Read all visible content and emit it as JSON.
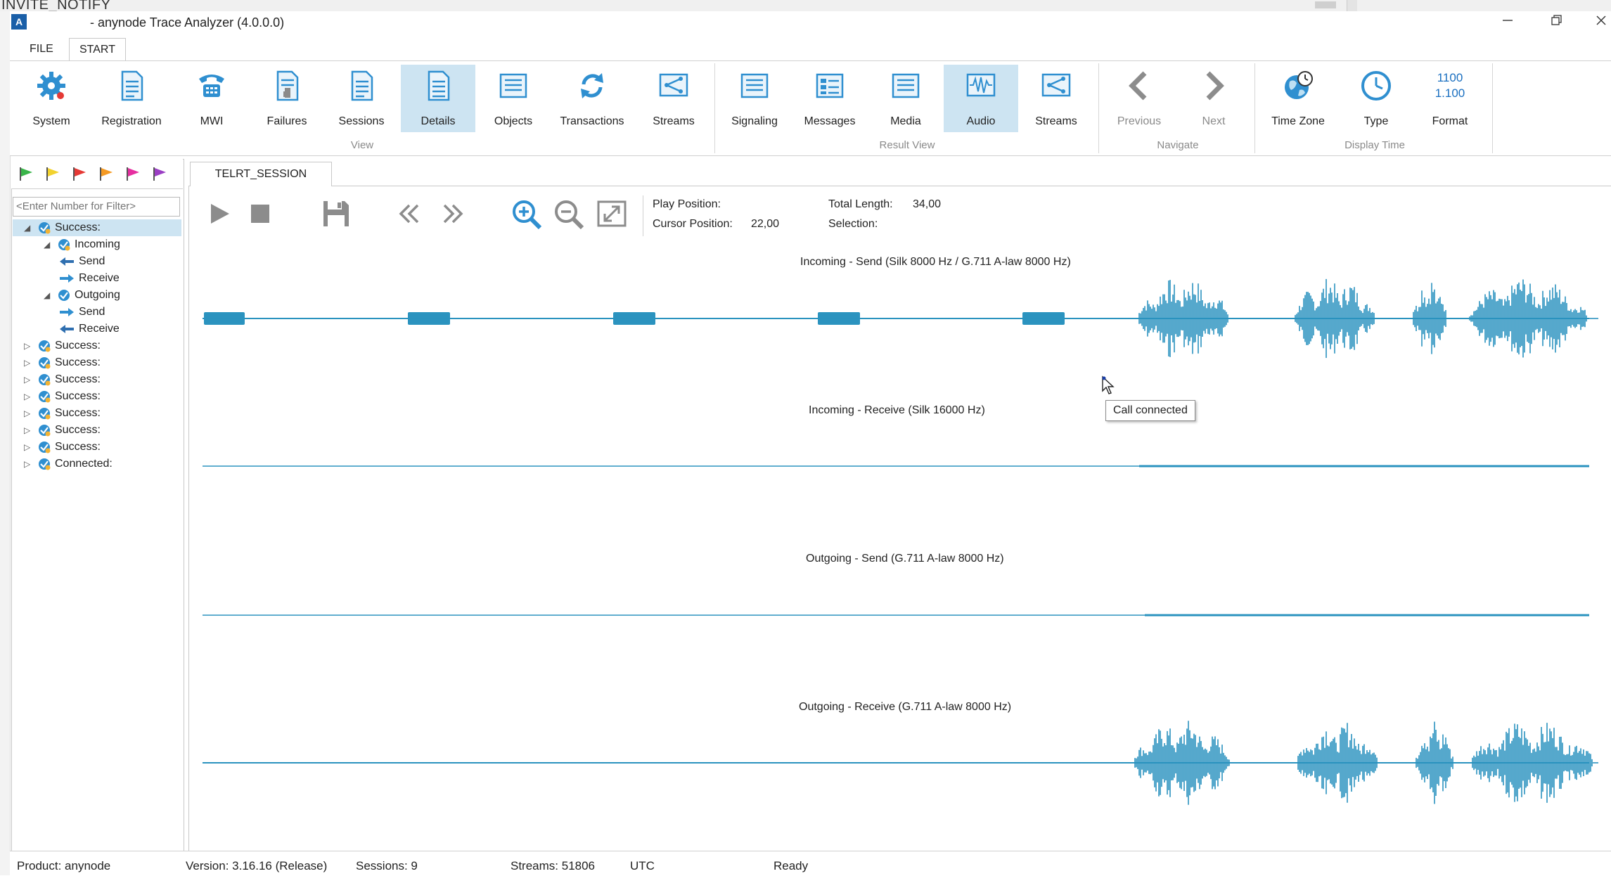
{
  "background_window": {
    "title": "INVITE_NOTIFY"
  },
  "window": {
    "title": "- anynode Trace Analyzer (4.0.0.0)",
    "icon_letter": "A"
  },
  "menu_tabs": [
    {
      "label": "FILE"
    },
    {
      "label": "START"
    }
  ],
  "ribbon": {
    "groups": [
      {
        "label": "View"
      },
      {
        "label": "Result View"
      },
      {
        "label": "Navigate"
      },
      {
        "label": "Display Time"
      }
    ],
    "view_buttons": [
      {
        "label": "System",
        "icon": "gear-icon"
      },
      {
        "label": "Registration",
        "icon": "document-icon"
      },
      {
        "label": "MWI",
        "icon": "phone-icon"
      },
      {
        "label": "Failures",
        "icon": "document-warning-icon"
      },
      {
        "label": "Sessions",
        "icon": "document-icon"
      },
      {
        "label": "Details",
        "icon": "document-details-icon",
        "selected": true
      },
      {
        "label": "Objects",
        "icon": "list-icon"
      },
      {
        "label": "Transactions",
        "icon": "refresh-icon"
      },
      {
        "label": "Streams",
        "icon": "streams-icon"
      }
    ],
    "result_buttons": [
      {
        "label": "Signaling",
        "icon": "list-icon"
      },
      {
        "label": "Messages",
        "icon": "messages-icon"
      },
      {
        "label": "Media",
        "icon": "list-icon"
      },
      {
        "label": "Audio",
        "icon": "audio-wave-icon",
        "selected": true
      },
      {
        "label": "Streams",
        "icon": "streams-icon"
      }
    ],
    "navigate_buttons": [
      {
        "label": "Previous",
        "icon": "chevron-left-icon"
      },
      {
        "label": "Next",
        "icon": "chevron-right-icon"
      }
    ],
    "display_time_buttons": [
      {
        "label": "Time Zone",
        "icon": "globe-clock-icon"
      },
      {
        "label": "Type",
        "icon": "clock-icon"
      },
      {
        "label": "Format",
        "icon": "number-format-icon",
        "icon_text_1": "1100",
        "icon_text_2": "1.100"
      }
    ]
  },
  "flags": [
    {
      "color": "#3ab54a",
      "icon": "green-flag-icon"
    },
    {
      "color": "#f2d22e",
      "icon": "yellow-flag-icon"
    },
    {
      "color": "#e53935",
      "icon": "red-flag-icon"
    },
    {
      "color": "#f59a23",
      "icon": "orange-flag-icon"
    },
    {
      "color": "#e62ea0",
      "icon": "pink-flag-icon"
    },
    {
      "color": "#9b3fc4",
      "icon": "purple-flag-icon"
    }
  ],
  "filter": {
    "placeholder": "<Enter Number for Filter>"
  },
  "tree": [
    {
      "label": "Success:",
      "expanded": true,
      "selected": true,
      "level": 0
    },
    {
      "label": "Incoming",
      "expanded": true,
      "level": 1
    },
    {
      "label": "Send",
      "level": 2,
      "icon": "arrow-left-icon"
    },
    {
      "label": "Receive",
      "level": 2,
      "icon": "arrow-right-icon"
    },
    {
      "label": "Outgoing",
      "expanded": true,
      "level": 1
    },
    {
      "label": "Send",
      "level": 2,
      "icon": "arrow-right-icon"
    },
    {
      "label": "Receive",
      "level": 2,
      "icon": "arrow-left-icon"
    },
    {
      "label": "Success:",
      "level": 0
    },
    {
      "label": "Success:",
      "level": 0
    },
    {
      "label": "Success:",
      "level": 0
    },
    {
      "label": "Success:",
      "level": 0
    },
    {
      "label": "Success:",
      "level": 0
    },
    {
      "label": "Success:",
      "level": 0
    },
    {
      "label": "Success:",
      "level": 0
    },
    {
      "label": "Connected:",
      "level": 0
    }
  ],
  "session_tab": {
    "label": "TELRT_SESSION"
  },
  "player_info": {
    "play_position_label": "Play Position:",
    "play_position_value": "",
    "cursor_position_label": "Cursor Position:",
    "cursor_position_value": "22,00",
    "total_length_label": "Total Length:",
    "total_length_value": "34,00",
    "selection_label": "Selection:",
    "selection_value": ""
  },
  "waveforms": [
    {
      "title": "Incoming - Send (Silk 8000 Hz / G.711 A-law 8000 Hz)"
    },
    {
      "title": "Incoming - Receive (Silk 16000 Hz)"
    },
    {
      "title": "Outgoing - Send (G.711 A-law 8000 Hz)"
    },
    {
      "title": "Outgoing - Receive (G.711 A-law 8000 Hz)"
    }
  ],
  "wave_color": "#2b93bf",
  "tooltip": {
    "text": "Call connected"
  },
  "status_bar": {
    "product": "Product: anynode",
    "version": "Version: 3.16.16 (Release)",
    "sessions": "Sessions: 9",
    "streams": "Streams: 51806",
    "timezone": "UTC",
    "state": "Ready"
  }
}
